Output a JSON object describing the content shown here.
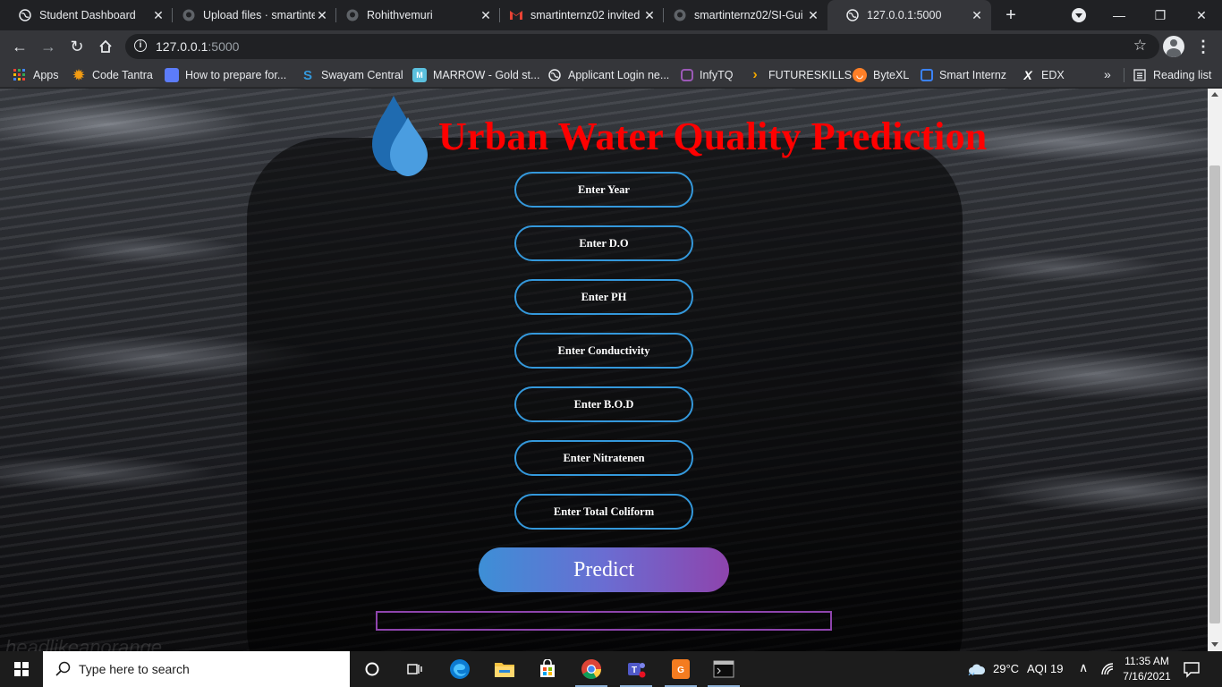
{
  "browser": {
    "tabs": [
      {
        "title": "Student Dashboard",
        "icon": "globe-icon",
        "active": false
      },
      {
        "title": "Upload files · smartinte",
        "icon": "github-icon",
        "active": false
      },
      {
        "title": "Rohithvemuri",
        "icon": "github-icon",
        "active": false
      },
      {
        "title": "smartinternz02 invited",
        "icon": "gmail-icon",
        "active": false
      },
      {
        "title": "smartinternz02/SI-Gui",
        "icon": "github-icon",
        "active": false
      },
      {
        "title": "127.0.0.1:5000",
        "icon": "globe-icon",
        "active": true
      }
    ],
    "url_host": "127.0.0.1",
    "url_port": ":5000",
    "bookmarks": [
      {
        "label": "Apps",
        "icon": "apps-grid-icon",
        "color": "#e8eaed"
      },
      {
        "label": "Code Tantra",
        "icon": "gear-sun-icon",
        "color": "#f39c12"
      },
      {
        "label": "How to prepare for...",
        "icon": "image-icon",
        "color": "#5c7cfa"
      },
      {
        "label": "Swayam Central",
        "icon": "swayam-icon",
        "color": "#3498db"
      },
      {
        "label": "MARROW - Gold st...",
        "icon": "marrow-icon",
        "color": "#5bc0de"
      },
      {
        "label": "Applicant Login ne...",
        "icon": "globe-icon",
        "color": "#e8eaed"
      },
      {
        "label": "InfyTQ",
        "icon": "infytq-icon",
        "color": "#9b59b6"
      },
      {
        "label": "FUTURESKILLS",
        "icon": "chevron-right-icon",
        "color": "#f0a500"
      },
      {
        "label": "ByteXL",
        "icon": "bytexl-icon",
        "color": "#ff7f27"
      },
      {
        "label": "Smart Internz",
        "icon": "smartinternz-icon",
        "color": "#3b82f6"
      },
      {
        "label": "EDX",
        "icon": "edx-icon",
        "color": "#ffffff"
      }
    ],
    "more": "»",
    "reading_list": "Reading list"
  },
  "page": {
    "title": "Urban Water Quality Prediction",
    "fields": [
      {
        "placeholder": "Enter Year"
      },
      {
        "placeholder": "Enter D.O"
      },
      {
        "placeholder": "Enter PH"
      },
      {
        "placeholder": "Enter Conductivity"
      },
      {
        "placeholder": "Enter B.O.D"
      },
      {
        "placeholder": "Enter Nitratenen"
      },
      {
        "placeholder": "Enter Total Coliform"
      }
    ],
    "predict_label": "Predict",
    "result_text": "",
    "colors": {
      "title": "#ff0000",
      "field_border": "#3498db",
      "result_border": "#8e44ad"
    }
  },
  "taskbar": {
    "search_placeholder": "Type here to search",
    "weather": "29°C",
    "aqi": "AQI 19",
    "time": "11:35 AM",
    "date": "7/16/2021"
  }
}
